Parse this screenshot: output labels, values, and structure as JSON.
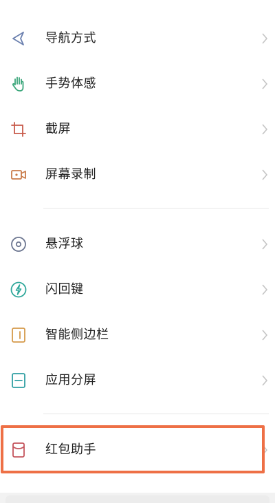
{
  "settings_list": {
    "group1": [
      {
        "label": "导航方式",
        "icon": "navigation-arrow-icon",
        "color": "#6a7fae"
      },
      {
        "label": "手势体感",
        "icon": "hand-gesture-icon",
        "color": "#3aa67a"
      },
      {
        "label": "截屏",
        "icon": "crop-icon",
        "color": "#c85a4a"
      },
      {
        "label": "屏幕录制",
        "icon": "video-record-icon",
        "color": "#c97a48"
      }
    ],
    "group2": [
      {
        "label": "悬浮球",
        "icon": "floating-ball-icon",
        "color": "#6c7690"
      },
      {
        "label": "闪回键",
        "icon": "flashback-bolt-icon",
        "color": "#2ea79a"
      },
      {
        "label": "智能侧边栏",
        "icon": "sidebar-icon",
        "color": "#d59a4a"
      },
      {
        "label": "应用分屏",
        "icon": "split-screen-icon",
        "color": "#2f9fa2"
      }
    ],
    "group3": [
      {
        "label": "红包助手",
        "icon": "red-envelope-icon",
        "color": "#c4545c"
      }
    ]
  },
  "colors": {
    "highlight_border": "#ee7046",
    "chevron": "#c4c4c4",
    "divider": "#e6e6e6"
  }
}
